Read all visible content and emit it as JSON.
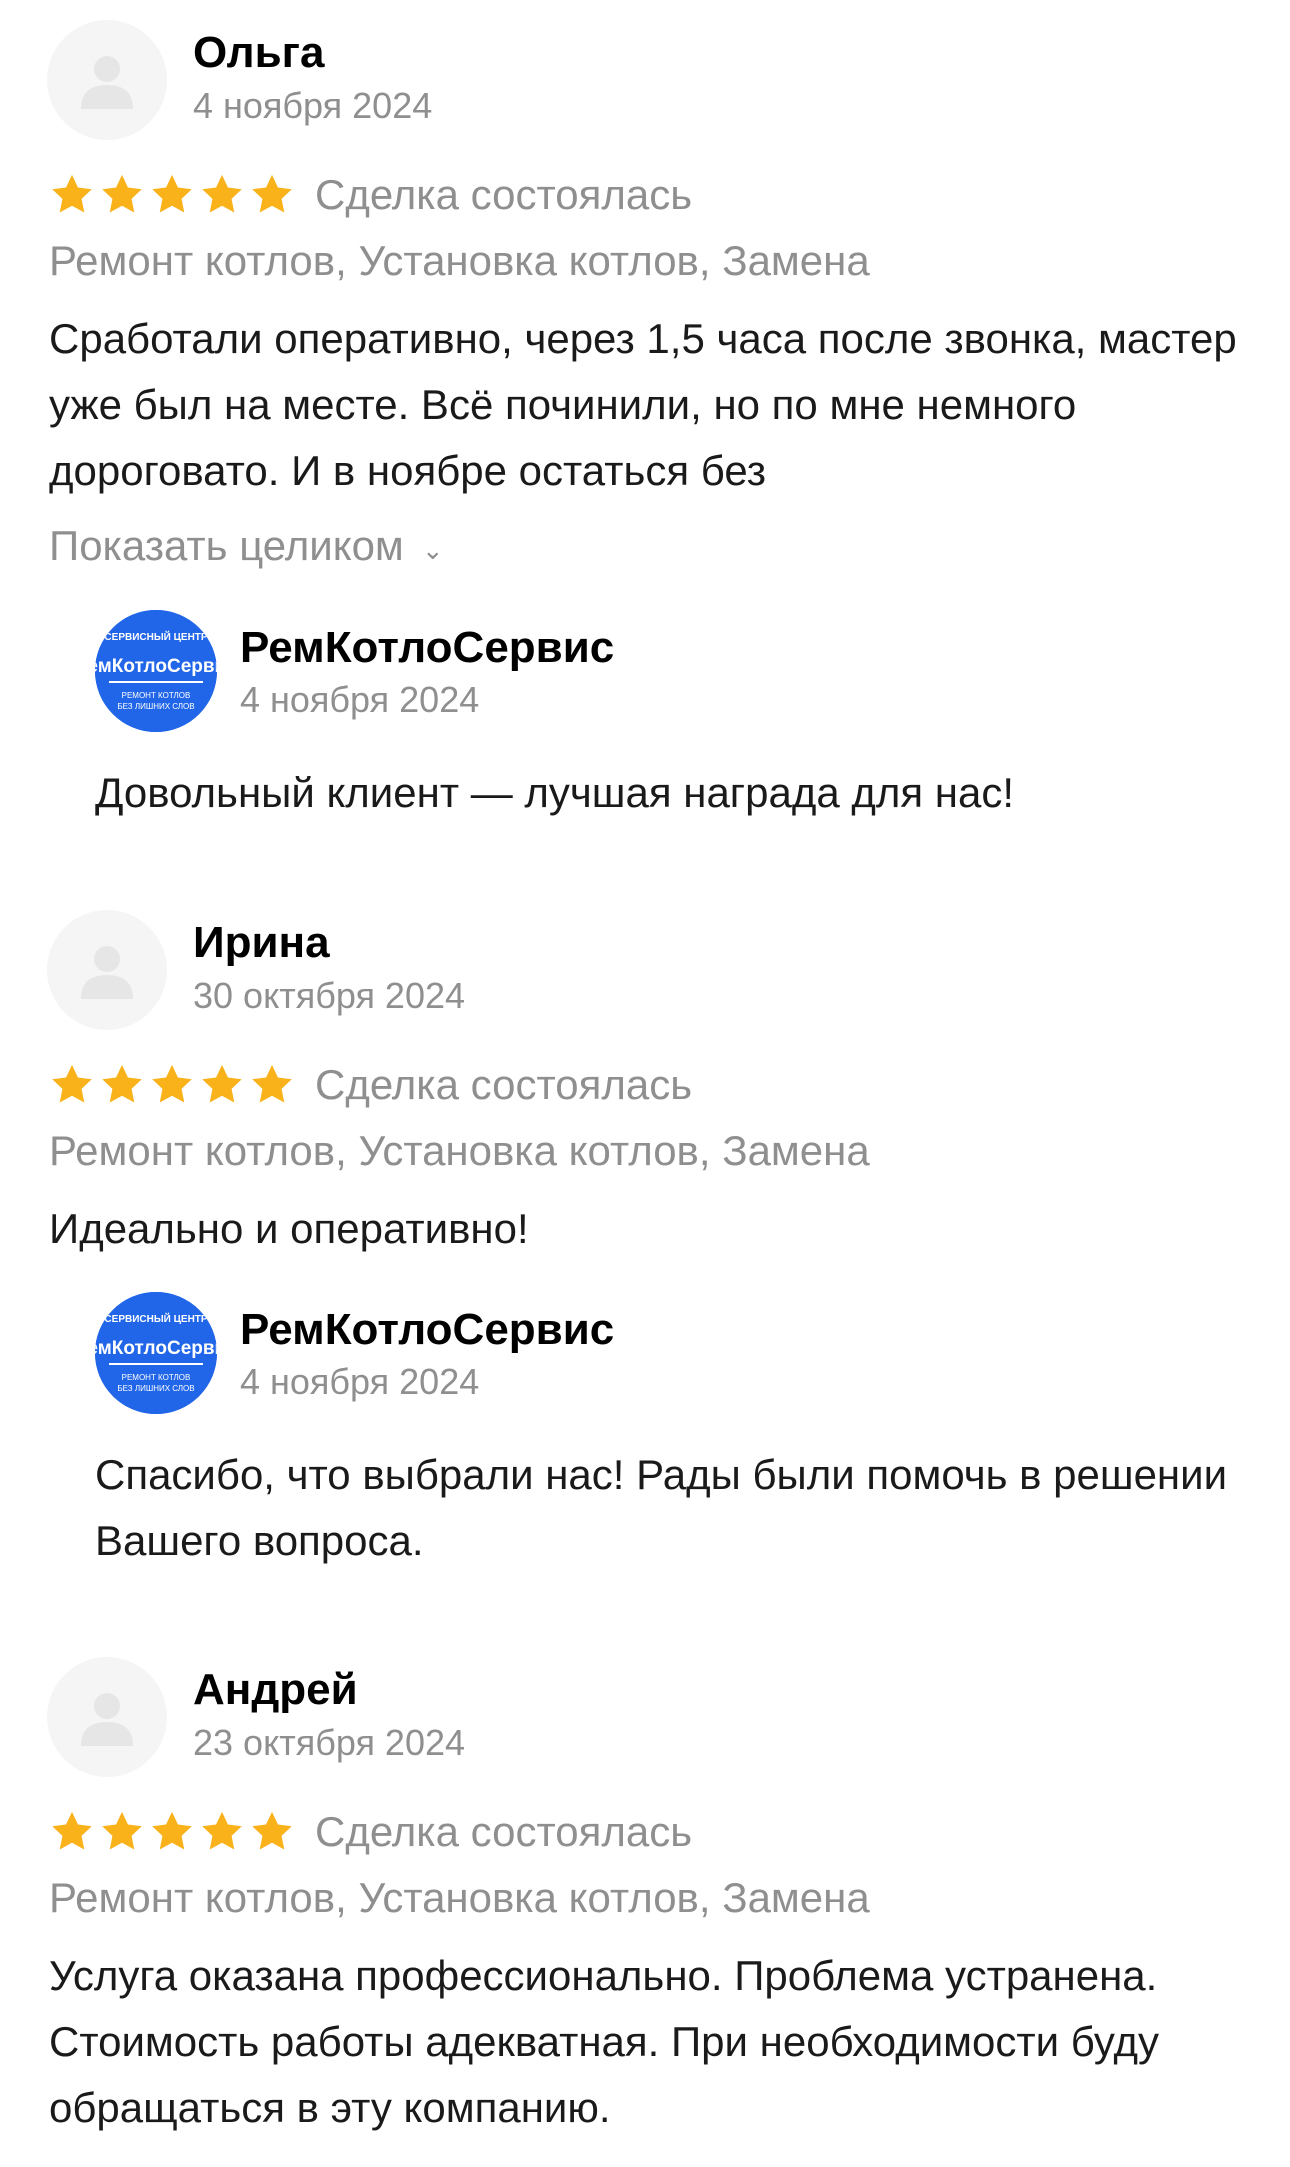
{
  "colors": {
    "star": "#f9b21a",
    "muted_text": "#8f8f8f",
    "logo_blue": "#2166e8"
  },
  "reviews": [
    {
      "author": "Ольга",
      "date": "4 ноября 2024",
      "rating": 5,
      "deal_status": "Сделка состоялась",
      "services": "Ремонт котлов, Установка котлов, Замена",
      "text": "Сработали оперативно, через 1,5 часа после звонка, мастер уже был на месте. Всё починили, но по мне немного дороговато. И в ноябре остаться без",
      "show_more": "Показать целиком",
      "reply": {
        "company": "РемКотлоСервис",
        "date": "4 ноября 2024",
        "text": "Довольный клиент — лучшая награда для нас!"
      }
    },
    {
      "author": "Ирина",
      "date": "30 октября 2024",
      "rating": 5,
      "deal_status": "Сделка состоялась",
      "services": "Ремонт котлов, Установка котлов, Замена",
      "text": "Идеально и оперативно!",
      "reply": {
        "company": "РемКотлоСервис",
        "date": "4 ноября 2024",
        "text": "Спасибо, что выбрали нас! Рады были помочь в решении Вашего вопроса."
      }
    },
    {
      "author": "Андрей",
      "date": "23 октября 2024",
      "rating": 5,
      "deal_status": "Сделка состоялась",
      "services": "Ремонт котлов, Установка котлов, Замена",
      "text": "Услуга оказана профессионально. Проблема устранена. Стоимость работы адекватная. При необходимости буду обращаться в эту компанию."
    }
  ],
  "logo_text": {
    "top": "СЕРВИСНЫЙ ЦЕНТР",
    "middle": "РемКотлоСервис",
    "bottom1": "РЕМОНТ КОТЛОВ",
    "bottom2": "БЕЗ ЛИШНИХ СЛОВ"
  }
}
